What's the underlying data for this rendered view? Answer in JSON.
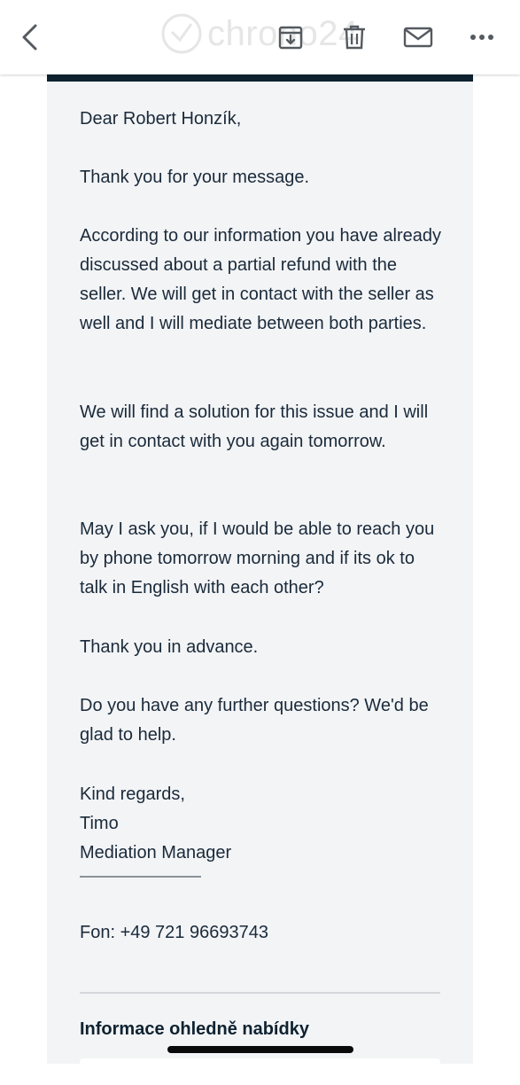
{
  "toolbar": {
    "back_icon": "chevron-left-icon",
    "watermark_text": "chrono24",
    "archive_icon": "archive-download-icon",
    "delete_icon": "trash-icon",
    "mail_icon": "envelope-icon",
    "more_icon": "ellipsis-icon"
  },
  "email": {
    "greeting": "Dear Robert Honzík,",
    "paragraphs": [
      "Thank you for your message.",
      "According to our information you have already discussed about a partial refund with the seller. We will get in contact with the seller as well and I will mediate between both parties.",
      "We will find a solution for this issue and I will get in contact with you again tomorrow.",
      "May I ask you, if I would be able to reach you by phone tomorrow morning and if its ok to talk in English with each other?",
      "Thank you in advance.",
      "Do you have any further questions? We'd be glad to help."
    ],
    "signature": {
      "closing": "Kind regards,",
      "name": "Timo",
      "role": "Mediation Manager"
    },
    "phone": "Fon: +49 721 96693743",
    "section_title": "Informace ohledně nabídky"
  },
  "colors": {
    "card_background": "#f3f4f6",
    "header_bar": "#0e2230",
    "text": "#1a2a3a"
  }
}
